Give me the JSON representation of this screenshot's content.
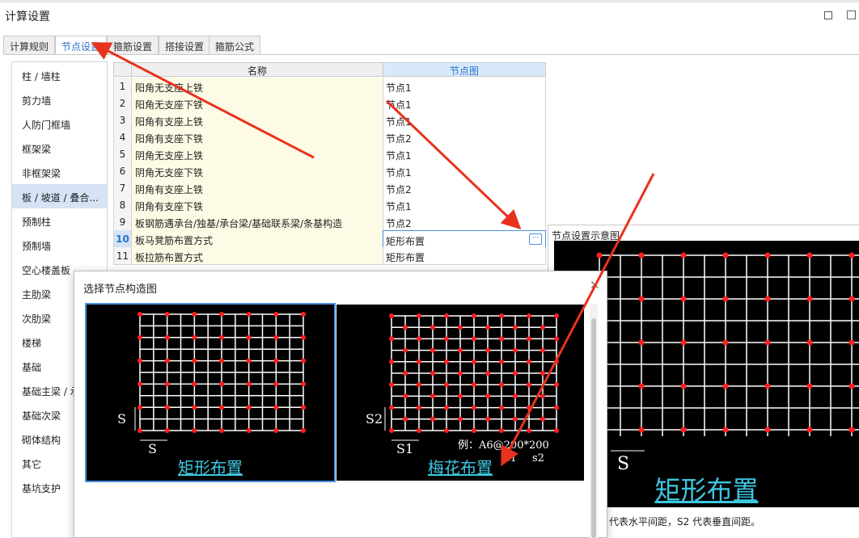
{
  "window": {
    "title": "计算设置",
    "maximize_glyph": "□",
    "close_glyph": "□"
  },
  "tabs": [
    {
      "label": "计算规则"
    },
    {
      "label": "节点设置"
    },
    {
      "label": "箍筋设置"
    },
    {
      "label": "搭接设置"
    },
    {
      "label": "箍筋公式"
    }
  ],
  "sidebar": {
    "items": [
      {
        "label": "柱 / 墙柱"
      },
      {
        "label": "剪力墙"
      },
      {
        "label": "人防门框墙"
      },
      {
        "label": "框架梁"
      },
      {
        "label": "非框架梁"
      },
      {
        "label": "板 / 坡道 / 叠合..."
      },
      {
        "label": "预制柱"
      },
      {
        "label": "预制墙"
      },
      {
        "label": "空心楼盖板"
      },
      {
        "label": "主肋梁"
      },
      {
        "label": "次肋梁"
      },
      {
        "label": "楼梯"
      },
      {
        "label": "基础"
      },
      {
        "label": "基础主梁 / 承..."
      },
      {
        "label": "基础次梁"
      },
      {
        "label": "砌体结构"
      },
      {
        "label": "其它"
      },
      {
        "label": "基坑支护"
      }
    ]
  },
  "table": {
    "headers": {
      "name": "名称",
      "node": "节点图"
    },
    "rows": [
      {
        "num": "1",
        "name": "阳角无支座上铁",
        "value": "节点1"
      },
      {
        "num": "2",
        "name": "阳角无支座下铁",
        "value": "节点1"
      },
      {
        "num": "3",
        "name": "阳角有支座上铁",
        "value": "节点1"
      },
      {
        "num": "4",
        "name": "阳角有支座下铁",
        "value": "节点2"
      },
      {
        "num": "5",
        "name": "阴角无支座上铁",
        "value": "节点1"
      },
      {
        "num": "6",
        "name": "阴角无支座下铁",
        "value": "节点1"
      },
      {
        "num": "7",
        "name": "阴角有支座上铁",
        "value": "节点2"
      },
      {
        "num": "8",
        "name": "阴角有支座下铁",
        "value": "节点1"
      },
      {
        "num": "9",
        "name": "板钢筋遇承台/独基/承台梁/基础联系梁/条基构造",
        "value": "节点2"
      },
      {
        "num": "10",
        "name": "板马凳筋布置方式",
        "value": "矩形布置"
      },
      {
        "num": "11",
        "name": "板拉筋布置方式",
        "value": "矩形布置"
      }
    ],
    "ellipsis_glyph": "···"
  },
  "preview": {
    "title": "节点设置示意图",
    "label": "矩形布置",
    "dim_label": "S",
    "note": "代表水平间距，S2 代表垂直间距。"
  },
  "dialog": {
    "title": "选择节点构造图",
    "close_glyph": "✕",
    "options": [
      {
        "label": "矩形布置",
        "dim_v": "S",
        "dim_h": "S"
      },
      {
        "label": "梅花布置",
        "dim_v": "S2",
        "dim_h": "S1",
        "example": "例：A6@200*200",
        "s1": "s1",
        "s2": "s2"
      }
    ]
  },
  "colors": {
    "accent": "#2b73c9",
    "annotation_arrow": "#e8321e",
    "rebar_dot": "#ff2020",
    "cyan_label": "#3ec6e0"
  }
}
